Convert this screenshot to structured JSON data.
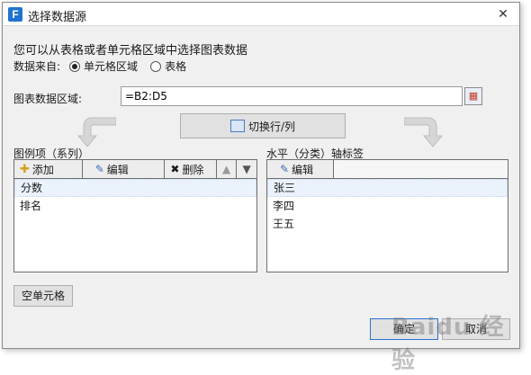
{
  "window": {
    "title": "选择数据源",
    "logo_letter": "F"
  },
  "hint": "您可以从表格或者单元格区域中选择图表数据",
  "source": {
    "label": "数据来自:",
    "options": [
      {
        "label": "单元格区域",
        "selected": true
      },
      {
        "label": "表格",
        "selected": false
      }
    ]
  },
  "range": {
    "label": "图表数据区域:",
    "value": "=B2:D5"
  },
  "switch_button": {
    "label": "切换行/列"
  },
  "series_panel": {
    "title": "图例项（系列）",
    "toolbar": {
      "add": "添加",
      "edit": "编辑",
      "delete": "删除"
    },
    "items": [
      "分数",
      "排名"
    ]
  },
  "axis_panel": {
    "title": "水平（分类）轴标签",
    "toolbar": {
      "edit": "编辑"
    },
    "items": [
      "张三",
      "李四",
      "王五"
    ]
  },
  "empty_cells_button": "空单元格",
  "footer": {
    "ok": "确定",
    "cancel": "取消"
  },
  "watermark": "Baidu 经验"
}
